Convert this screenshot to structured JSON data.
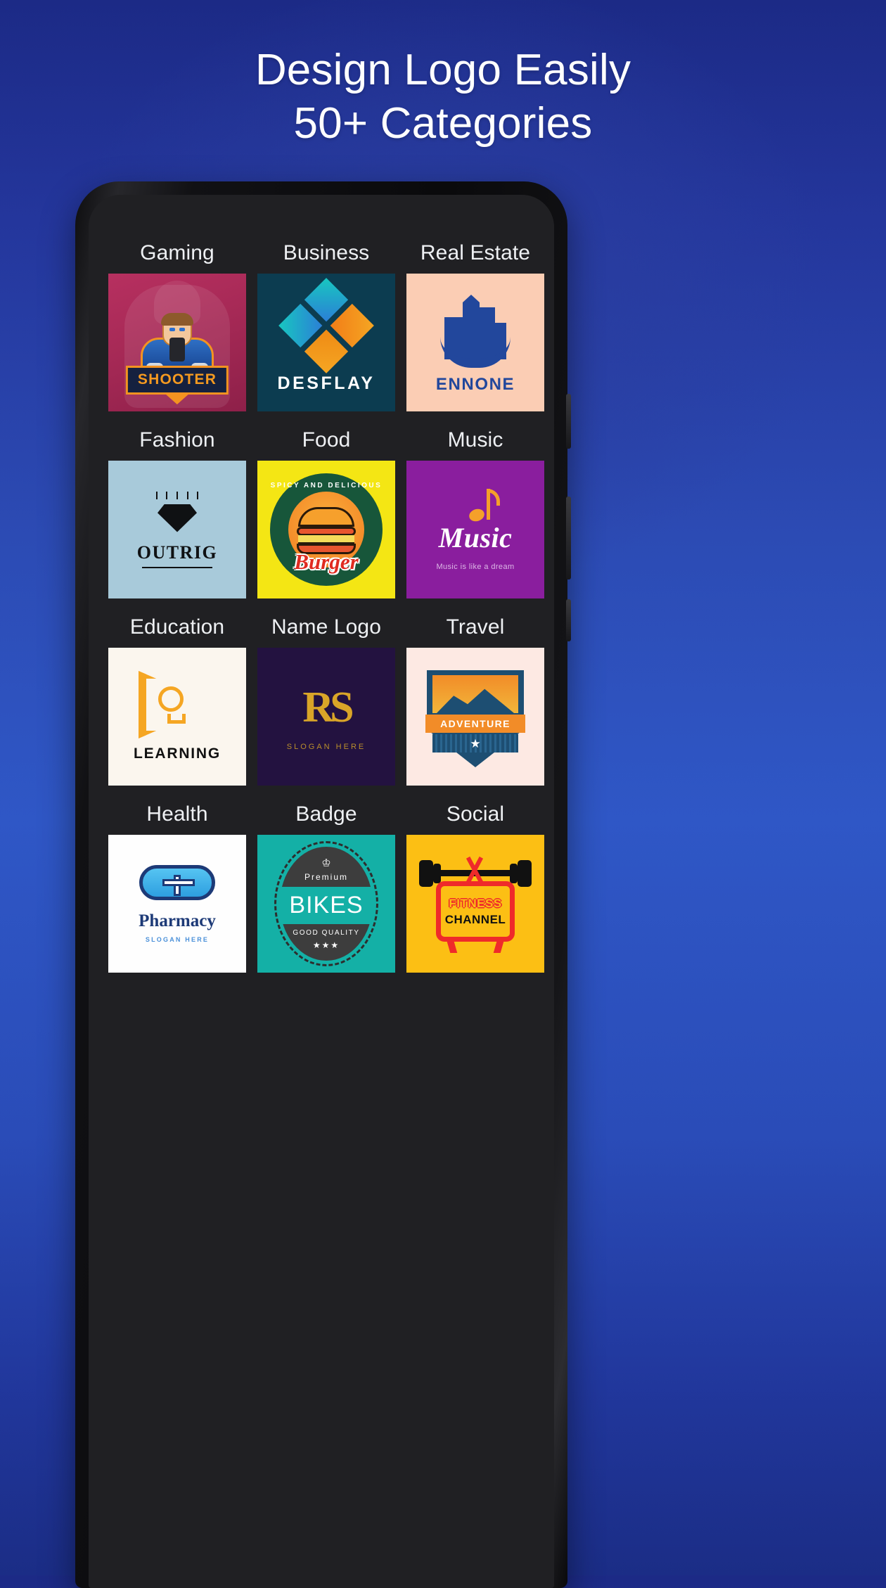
{
  "promo": {
    "headline_line1": "Design Logo Easily",
    "headline_line2": "50+ Categories"
  },
  "phone": {
    "screen_background": "#202023",
    "frame_color": "#111114"
  },
  "categories": [
    {
      "label": "Gaming",
      "tile_bg": "#a82a57",
      "logo": {
        "name": "SHOOTER",
        "style": "gaming-mascot"
      }
    },
    {
      "label": "Business",
      "tile_bg": "#0c3c50",
      "logo": {
        "name": "DESFLAY",
        "style": "diamond-mark"
      }
    },
    {
      "label": "Real Estate",
      "tile_bg": "#fbcdb4",
      "logo": {
        "name": "ENNONE",
        "style": "building-mark"
      }
    },
    {
      "label": "Fashion",
      "tile_bg": "#a8cada",
      "logo": {
        "name": "OUTRIG",
        "style": "diamond-gem"
      }
    },
    {
      "label": "Food",
      "tile_bg": "#f4e614",
      "logo": {
        "name": "Burger",
        "tagline": "SPICY AND DELICIOUS",
        "style": "burger-badge"
      }
    },
    {
      "label": "Music",
      "tile_bg": "#8a1e9e",
      "logo": {
        "name": "Music",
        "tagline": "Music is like a dream",
        "style": "script-note"
      }
    },
    {
      "label": "Education",
      "tile_bg": "#fbf6ee",
      "logo": {
        "name": "LEARNING",
        "style": "play-bulb"
      }
    },
    {
      "label": "Name Logo",
      "tile_bg": "#231240",
      "logo": {
        "name": "RS",
        "tagline": "SLOGAN HERE",
        "style": "monogram"
      }
    },
    {
      "label": "Travel",
      "tile_bg": "#fde9e3",
      "logo": {
        "name": "ADVENTURE",
        "style": "mountain-shield"
      }
    },
    {
      "label": "Health",
      "tile_bg": "#fefefe",
      "logo": {
        "name": "Pharmacy",
        "tagline": "SLOGAN HERE",
        "style": "pill-cross"
      }
    },
    {
      "label": "Badge",
      "tile_bg": "#14b0a6",
      "logo": {
        "name": "BIKES",
        "top_text": "Premium",
        "bottom_text": "GOOD QUALITY",
        "stars": "★★★",
        "crown": "♔",
        "style": "oval-badge"
      }
    },
    {
      "label": "Social",
      "tile_bg": "#fcbf14",
      "logo": {
        "name_line1": "FITNESS",
        "name_line2": "CHANNEL",
        "style": "tv-dumbbell"
      }
    }
  ]
}
